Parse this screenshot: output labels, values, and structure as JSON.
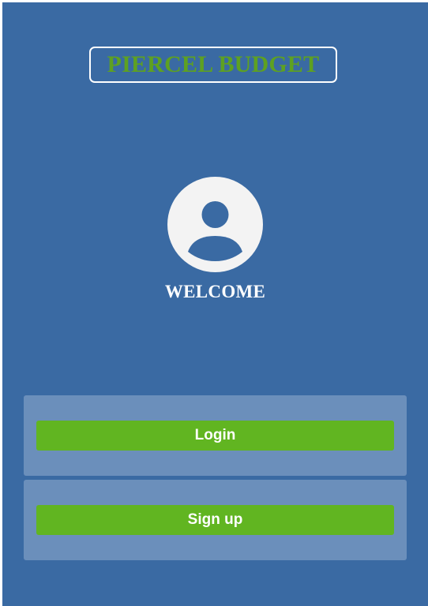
{
  "app": {
    "brand_title": "PIERCEL BUDGET",
    "welcome_text": "WELCOME"
  },
  "avatar": {
    "icon": "user-avatar-icon"
  },
  "actions": {
    "login_label": "Login",
    "signup_label": "Sign up"
  },
  "colors": {
    "background": "#3a6aa3",
    "panel": "#6b8fbb",
    "accent_green": "#61b521",
    "brand_green": "#5ea121",
    "avatar_fill": "#f3f3f3"
  }
}
